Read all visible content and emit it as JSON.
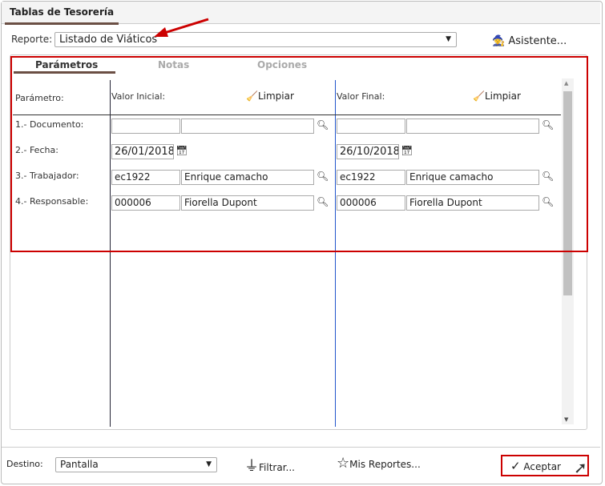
{
  "window_tab": "Tablas de Tesorería",
  "reporte": {
    "label": "Reporte:",
    "value": "Listado de Viáticos"
  },
  "asistente": "Asistente...",
  "tabs": [
    "Parámetros",
    "Notas",
    "Opciones"
  ],
  "headers": {
    "param": "Parámetro:",
    "inicial": "Valor Inicial:",
    "final": "Valor Final:",
    "limpiar": "Limpiar"
  },
  "rows": [
    {
      "label": "1.- Documento:",
      "ini_code": "",
      "ini_name": "",
      "fin_code": "",
      "fin_name": ""
    },
    {
      "label": "2.- Fecha:",
      "ini_date": "26/01/2018",
      "fin_date": "26/10/2018"
    },
    {
      "label": "3.- Trabajador:",
      "ini_code": "ec1922",
      "ini_name": "Enrique camacho",
      "fin_code": "ec1922",
      "fin_name": "Enrique camacho"
    },
    {
      "label": "4.- Responsable:",
      "ini_code": "000006",
      "ini_name": "Fiorella Dupont",
      "fin_code": "000006",
      "fin_name": "Fiorella Dupont"
    }
  ],
  "footer": {
    "destino_label": "Destino:",
    "destino_value": "Pantalla",
    "filtrar": "Filtrar...",
    "mis_reportes": "Mis Reportes...",
    "aceptar": "Aceptar"
  }
}
